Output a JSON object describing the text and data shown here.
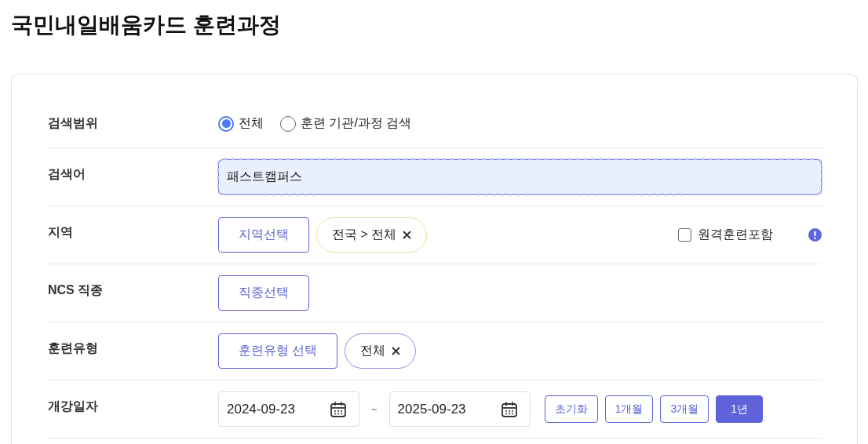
{
  "title": "국민내일배움카드 훈련과정",
  "rows": [
    {
      "kind": "radio",
      "label": "검색범위",
      "options": [
        {
          "label": "전체",
          "selected": true
        },
        {
          "label": "훈련 기관/과정 검색",
          "selected": false
        }
      ]
    },
    {
      "kind": "text",
      "label": "검색어",
      "value": "패스트캠퍼스"
    },
    {
      "kind": "select",
      "label": "지역",
      "button": "지역선택",
      "chips": [
        {
          "label": "전국 > 전체",
          "color": "#e9e29a"
        }
      ],
      "checkbox": {
        "label": "원격훈련포함",
        "checked": false
      }
    },
    {
      "kind": "select",
      "label": "NCS 직종",
      "button": "직종선택"
    },
    {
      "kind": "select",
      "label": "훈련유형",
      "button": "훈련유형 선택",
      "chips": [
        {
          "label": "전체",
          "color": "#8e92e6"
        }
      ]
    },
    {
      "kind": "date",
      "label": "개강일자",
      "from": "2024-09-23",
      "separator": "~",
      "to": "2025-09-23",
      "periods": [
        {
          "label": "초기화",
          "selected": false
        },
        {
          "label": "1개월",
          "selected": false
        },
        {
          "label": "3개월",
          "selected": false
        },
        {
          "label": "1년",
          "selected": true
        }
      ]
    }
  ]
}
